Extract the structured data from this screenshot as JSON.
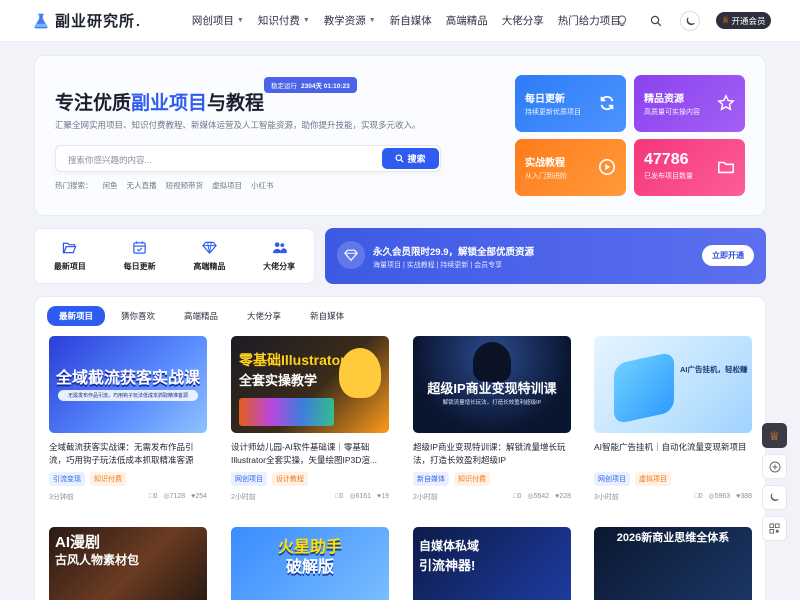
{
  "header": {
    "logo_text": "副业研究所",
    "logo_dot": ".",
    "nav": [
      {
        "label": "网创项目",
        "dropdown": true
      },
      {
        "label": "知识付费",
        "dropdown": true
      },
      {
        "label": "教学资源",
        "dropdown": true
      },
      {
        "label": "新自媒体",
        "dropdown": false
      },
      {
        "label": "高端精品",
        "dropdown": false
      },
      {
        "label": "大佬分享",
        "dropdown": false
      },
      {
        "label": "热门给力项目",
        "dropdown": false
      }
    ],
    "vip_button": "开通会员"
  },
  "hero": {
    "title_pre": "专注优质",
    "title_highlight": "副业项目",
    "title_post": "与教程",
    "run_label": "稳定运行",
    "run_time": "2304天 01:10:23",
    "subtitle": "汇聚全网实用项目、知识付费教程、新媒体运营及人工智能资源，助你提升技能，实现多元收入。",
    "search_placeholder": "搜索你感兴趣的内容...",
    "search_button": "搜索",
    "hot_label": "热门搜索：",
    "hot_terms": [
      "闲鱼",
      "无人直播",
      "短视频带货",
      "虚拟项目",
      "小红书"
    ],
    "cards": [
      {
        "title": "每日更新",
        "sub": "持续更新优质项目"
      },
      {
        "title": "精品资源",
        "sub": "高质量可实操内容"
      },
      {
        "title": "实战教程",
        "sub": "从入门到进阶"
      },
      {
        "number": "47786",
        "sub": "已发布项目数量"
      }
    ]
  },
  "quick_links": [
    {
      "label": "最新项目",
      "icon": "folder-open-icon"
    },
    {
      "label": "每日更新",
      "icon": "calendar-icon"
    },
    {
      "label": "高端精品",
      "icon": "diamond-icon"
    },
    {
      "label": "大佬分享",
      "icon": "users-icon"
    }
  ],
  "promo": {
    "title": "永久会员限时29.9，解锁全部优质资源",
    "sub": "海量项目 | 实战教程 | 持续更新 | 会员专享",
    "button": "立即开通"
  },
  "tabs": [
    "最新项目",
    "猜你喜欢",
    "高端精品",
    "大佬分享",
    "新自媒体"
  ],
  "posts": [
    {
      "title": "全域截流获客实战课：无需发布作品引流，巧用钩子玩法低成本抓取精准客源",
      "tags": [
        {
          "label": "引流变现",
          "color": "blue"
        },
        {
          "label": "知识付费",
          "color": "orange"
        }
      ],
      "time": "3分钟前",
      "comments": "0",
      "views": "7128",
      "likes": "254",
      "thumb_text": "全域截流获客实战课",
      "thumb_sub": "无需发布作品引流，巧用钩子玩法低成本抓取精准客源"
    },
    {
      "title": "设计师幼儿园-AI软件基础课｜零基础Illustrator全套实操，矢量绘图IP3D渲...",
      "tags": [
        {
          "label": "网创项目",
          "color": "blue"
        },
        {
          "label": "设计教程",
          "color": "orange"
        }
      ],
      "time": "2小时前",
      "comments": "0",
      "views": "6161",
      "likes": "19",
      "thumb_text": "零基础Illustrator",
      "thumb_sub": "全套实操教学"
    },
    {
      "title": "超级IP商业变现特训课：解锁流量增长玩法，打造长效盈利超级IP",
      "tags": [
        {
          "label": "新自媒体",
          "color": "blue"
        },
        {
          "label": "知识付费",
          "color": "orange"
        }
      ],
      "time": "2小时前",
      "comments": "0",
      "views": "5542",
      "likes": "228",
      "thumb_text": "超级IP商业变现特训课",
      "thumb_sub": "解锁流量增长玩法，打造长效盈利超级IP"
    },
    {
      "title": "AI智能广告挂机｜自动化流量变现新项目",
      "tags": [
        {
          "label": "网创项目",
          "color": "blue"
        },
        {
          "label": "虚拟项目",
          "color": "orange"
        }
      ],
      "time": "3小时前",
      "comments": "0",
      "views": "5963",
      "likes": "388",
      "thumb_text": "AI广告挂机，轻松赚",
      "thumb_sub": ""
    }
  ],
  "posts_row2": [
    {
      "thumb_text": "AI漫剧",
      "thumb_sub": "古风人物素材包"
    },
    {
      "thumb_text": "火星助手",
      "thumb_sub": "破解版"
    },
    {
      "thumb_text": "自媒体私域",
      "thumb_sub": "引流神器!"
    },
    {
      "thumb_text": "2026新商业思维全体系",
      "thumb_sub": ""
    }
  ],
  "colors": {
    "accent": "#2f5cf0",
    "card_blue": "#2d7cf7",
    "card_purple": "#8a43ee",
    "card_orange": "#ff7b1c",
    "card_pink": "#f5357a",
    "promo": "#4a60e8"
  }
}
